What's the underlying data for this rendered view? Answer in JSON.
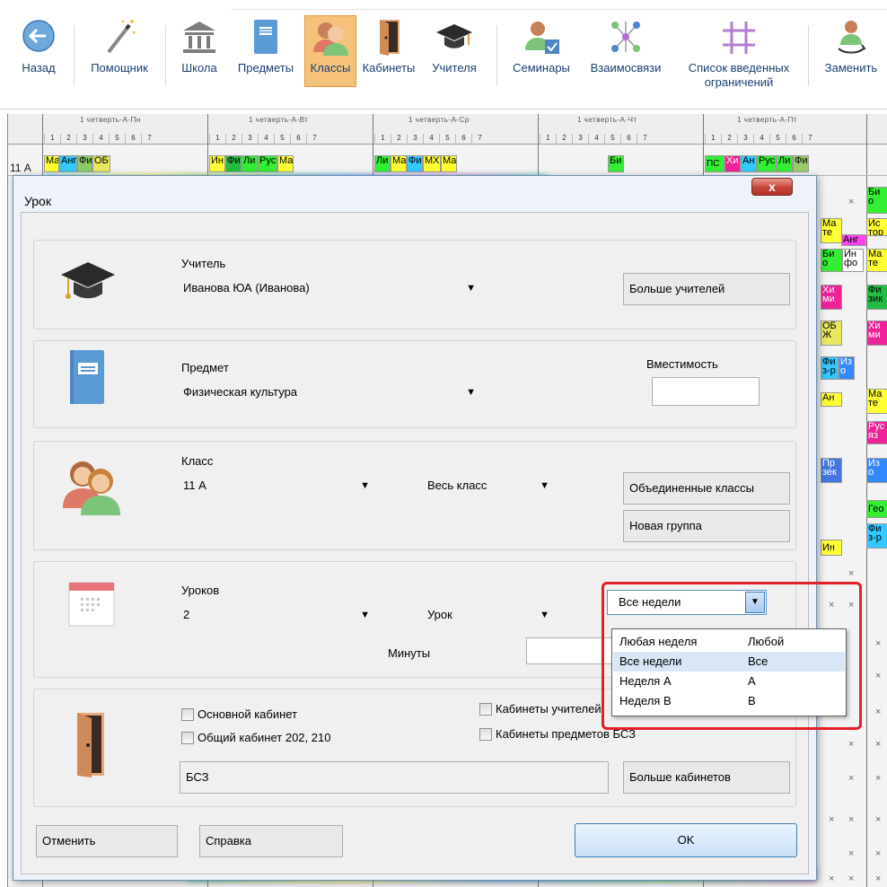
{
  "toolbar": {
    "items": [
      {
        "label": "Назад",
        "icon": "back-arrow-icon"
      },
      {
        "label": "Помощник",
        "icon": "magic-wand-icon"
      },
      {
        "label": "Школа",
        "icon": "school-building-icon"
      },
      {
        "label": "Предметы",
        "icon": "subject-book-icon"
      },
      {
        "label": "Классы",
        "icon": "class-people-icon"
      },
      {
        "label": "Кабинеты",
        "icon": "door-icon"
      },
      {
        "label": "Учителя",
        "icon": "graduation-cap-icon"
      },
      {
        "label": "Семинары",
        "icon": "seminar-user-icon"
      },
      {
        "label": "Взаимосвязи",
        "icon": "relations-icon"
      },
      {
        "label": "Список введенных",
        "label2": "ограничений",
        "icon": "constraints-grid-icon"
      },
      {
        "label": "Заменить",
        "icon": "replace-user-icon"
      }
    ],
    "active": "Классы"
  },
  "timetable": {
    "days": [
      "1 четверть-А-Пн",
      "1 четверть-А-Вт",
      "1 четверть-А-Ср",
      "1 четверть-А-Чт",
      "1 четверть-А-Пт"
    ],
    "periods": [
      "1",
      "2",
      "3",
      "4",
      "5",
      "6",
      "7"
    ],
    "row_label": "11 А",
    "row_prefix": "1",
    "cells_mon": [
      "Ма",
      "Анг",
      "Фи",
      "ОБ"
    ],
    "cells_tue": [
      "Ин",
      "Фи",
      "Ли",
      "Рус",
      "Ма"
    ],
    "cells_wed": [
      "Ли",
      "Ма",
      "Фи",
      "МХ",
      "Ма"
    ],
    "cells_thu": [
      "Би"
    ],
    "cells_fri": [
      "ПС",
      "Хи",
      "Ан",
      "Рус",
      "Ли",
      "Фи"
    ],
    "right_cells": [
      "Би о",
      "Ма те",
      "Ис тор",
      "Анг",
      "Би о",
      "Ин фо",
      "Ма те",
      "Хи ми",
      "Фи зик",
      "ОБ Ж",
      "Хи ми",
      "Фи з-р",
      "Из о",
      "Ан",
      "Ма те",
      "Рус яз",
      "Пр зек",
      "Из о",
      "Гео",
      "Ин",
      "Фи з-р"
    ],
    "mark": "×"
  },
  "dialog": {
    "title": "Урок",
    "close": "x",
    "teacher": {
      "label": "Учитель",
      "value": "Иванова ЮА (Иванова)",
      "more_btn": "Больше учителей"
    },
    "subject": {
      "label": "Предмет",
      "value": "Физическая культура",
      "capacity_label": "Вместимость"
    },
    "class": {
      "label": "Класс",
      "value": "11 А",
      "group_value": "Весь класс",
      "merged_btn": "Объединенные классы",
      "new_group_btn": "Новая группа"
    },
    "lessons": {
      "label": "Уроков",
      "count": "2",
      "unit": "Урок",
      "minutes_label": "Минуты",
      "week_value": "Все недели"
    },
    "week_options": [
      {
        "name": "Любая неделя",
        "short": "Любой"
      },
      {
        "name": "Все недели",
        "short": "Все"
      },
      {
        "name": "Неделя A",
        "short": "A"
      },
      {
        "name": "Неделя B",
        "short": "B"
      }
    ],
    "week_selected_index": 1,
    "rooms": {
      "main_room": "Основной кабинет",
      "shared_room": "Общий кабинет 202, 210",
      "teacher_rooms": "Кабинеты учителей",
      "subject_rooms": "Кабинеты предметов БСЗ",
      "room_value": "БСЗ",
      "more_btn": "Больше кабинетов"
    },
    "cancel": "Отменить",
    "help": "Справка",
    "ok": "OK"
  }
}
